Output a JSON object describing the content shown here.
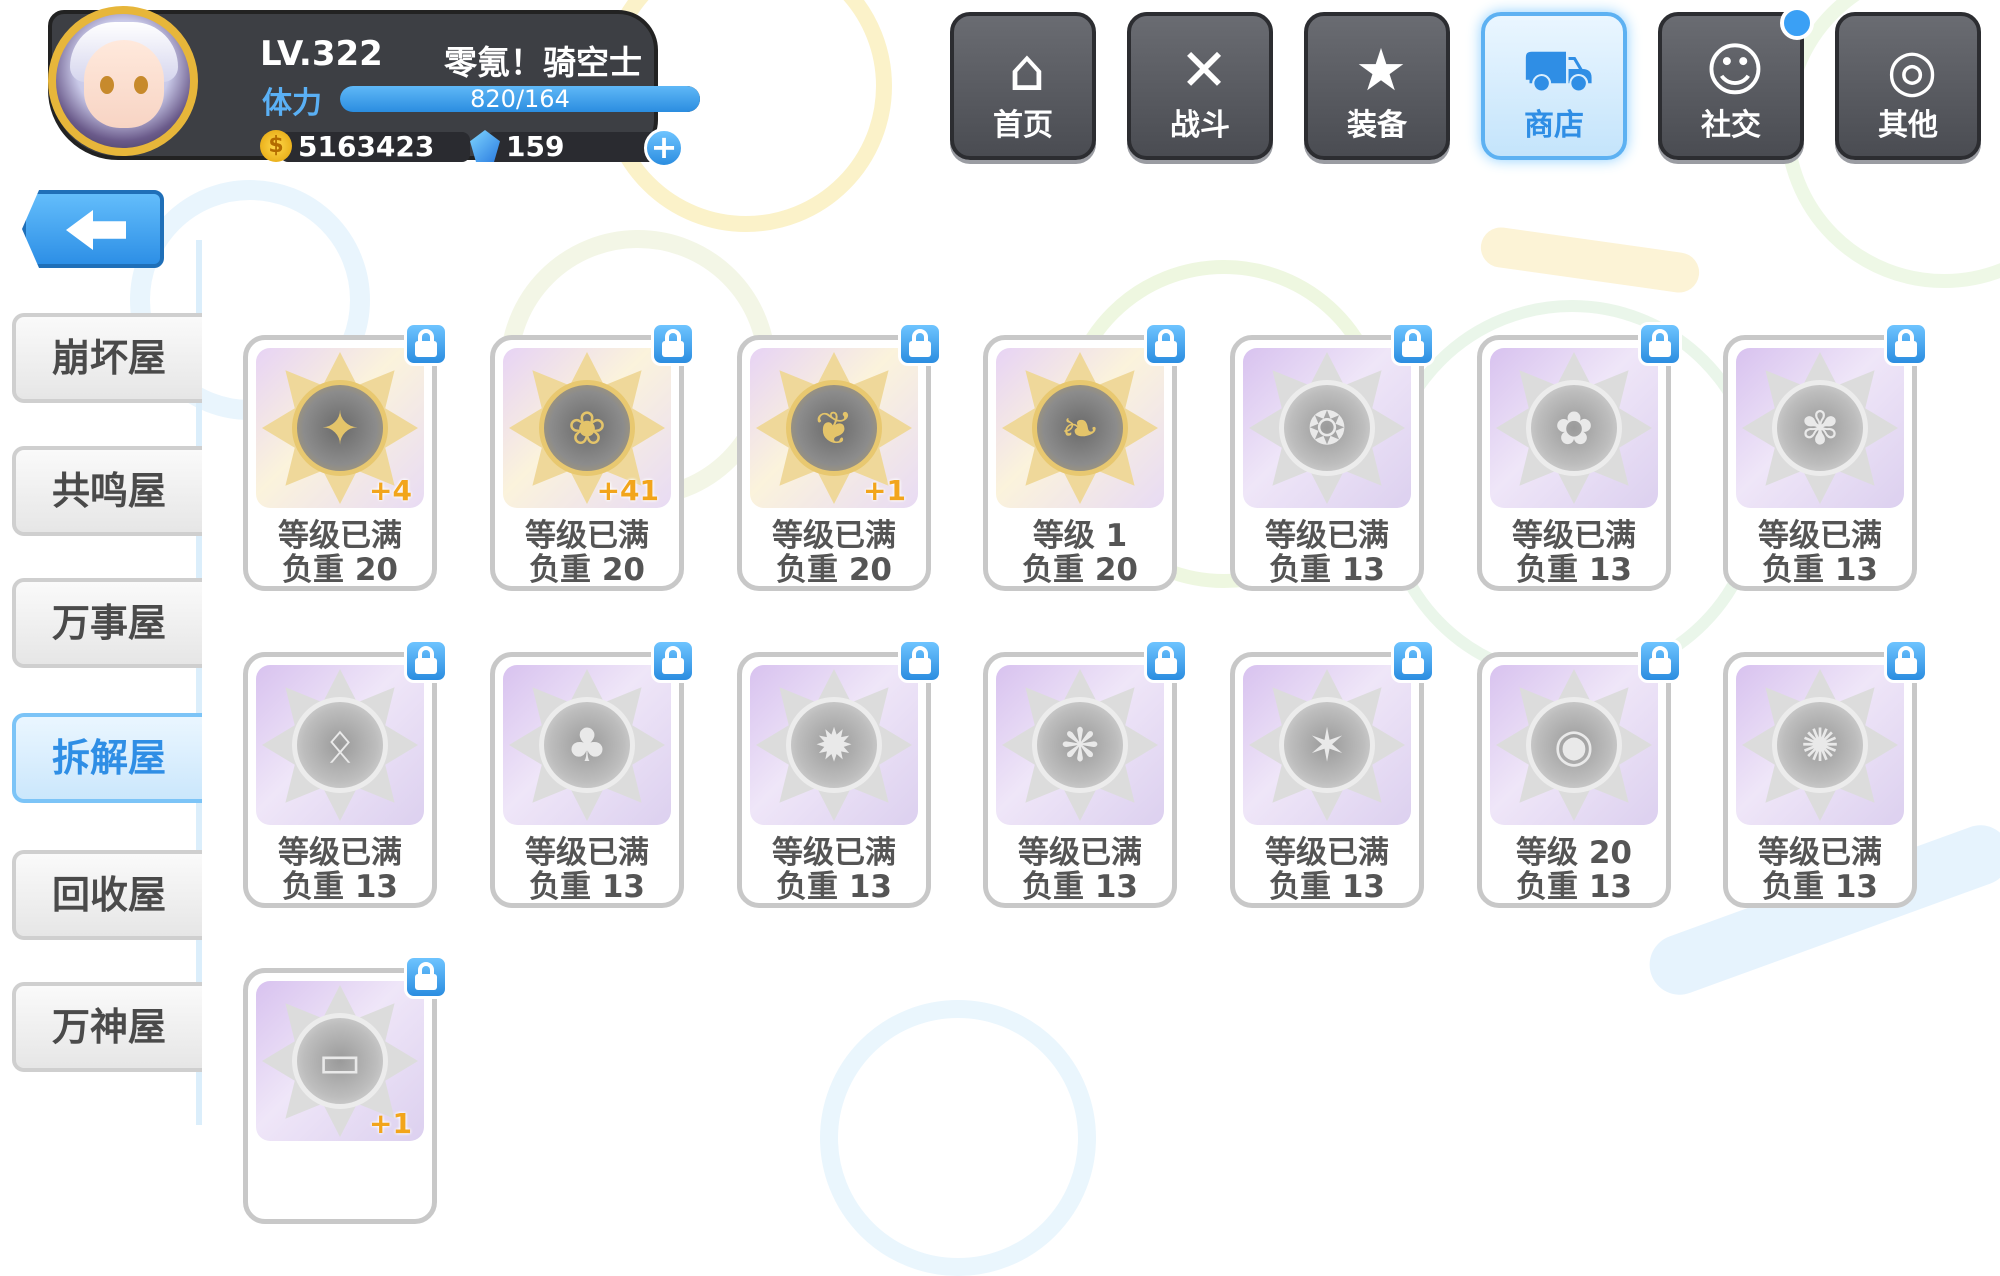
{
  "player": {
    "level": "LV.322",
    "name": "零氪！骑空士",
    "stamina_label": "体力",
    "stamina_text": "820/164",
    "stamina_fill": 1.0,
    "coins": "5163423",
    "gems": "159",
    "add_label": "+"
  },
  "nav": [
    {
      "label": "首页",
      "icon": "house-icon"
    },
    {
      "label": "战斗",
      "icon": "crossed-guns-icon"
    },
    {
      "label": "装备",
      "icon": "star-gun-icon"
    },
    {
      "label": "商店",
      "icon": "shop-cart-icon",
      "active": true
    },
    {
      "label": "社交",
      "icon": "chat-character-icon",
      "notify": true
    },
    {
      "label": "其他",
      "icon": "settings-ear-icon"
    }
  ],
  "sidebar": [
    {
      "label": "崩坏屋"
    },
    {
      "label": "共鸣屋"
    },
    {
      "label": "万事屋"
    },
    {
      "label": "拆解屋",
      "active": true
    },
    {
      "label": "回收屋"
    },
    {
      "label": "万神屋"
    }
  ],
  "cards": [
    {
      "line1": "等级已满",
      "line2": "负重 20",
      "bonus": "+4",
      "tier": "gold",
      "glyph": "✦"
    },
    {
      "line1": "等级已满",
      "line2": "负重 20",
      "bonus": "+41",
      "tier": "gold",
      "glyph": "❀"
    },
    {
      "line1": "等级已满",
      "line2": "负重 20",
      "bonus": "+1",
      "tier": "gold",
      "glyph": "❦"
    },
    {
      "line1": "等级 1",
      "line2": "负重 20",
      "bonus": "",
      "tier": "gold",
      "glyph": "❧"
    },
    {
      "line1": "等级已满",
      "line2": "负重 13",
      "bonus": "",
      "tier": "silver",
      "glyph": "❂"
    },
    {
      "line1": "等级已满",
      "line2": "负重 13",
      "bonus": "",
      "tier": "silver",
      "glyph": "✿"
    },
    {
      "line1": "等级已满",
      "line2": "负重 13",
      "bonus": "",
      "tier": "silver",
      "glyph": "✾"
    },
    {
      "line1": "等级已满",
      "line2": "负重 13",
      "bonus": "",
      "tier": "silver",
      "glyph": "ᛟ"
    },
    {
      "line1": "等级已满",
      "line2": "负重 13",
      "bonus": "",
      "tier": "silver",
      "glyph": "♣"
    },
    {
      "line1": "等级已满",
      "line2": "负重 13",
      "bonus": "",
      "tier": "silver",
      "glyph": "✹"
    },
    {
      "line1": "等级已满",
      "line2": "负重 13",
      "bonus": "",
      "tier": "silver",
      "glyph": "❋"
    },
    {
      "line1": "等级已满",
      "line2": "负重 13",
      "bonus": "",
      "tier": "silver",
      "glyph": "✶"
    },
    {
      "line1": "等级 20",
      "line2": "负重 13",
      "bonus": "",
      "tier": "silver",
      "glyph": "◉"
    },
    {
      "line1": "等级已满",
      "line2": "负重 13",
      "bonus": "",
      "tier": "silver",
      "glyph": "✺"
    },
    {
      "line1": "",
      "line2": "",
      "bonus": "+1",
      "tier": "silver",
      "glyph": "▭"
    }
  ]
}
